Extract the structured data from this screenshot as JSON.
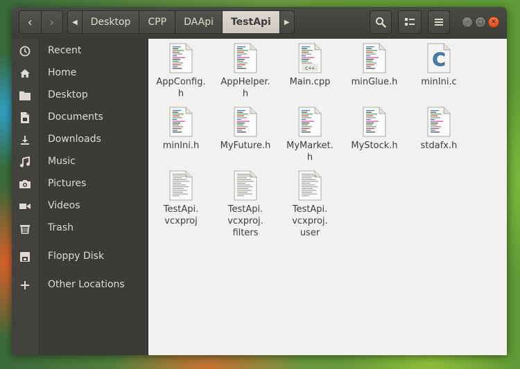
{
  "breadcrumb": {
    "items": [
      "Desktop",
      "CPP",
      "DAApi",
      "TestApi"
    ],
    "active": "TestApi"
  },
  "sidebar": {
    "items": [
      {
        "label": "Recent",
        "icon": "clock-icon"
      },
      {
        "label": "Home",
        "icon": "home-icon"
      },
      {
        "label": "Desktop",
        "icon": "folder-icon"
      },
      {
        "label": "Documents",
        "icon": "document-icon"
      },
      {
        "label": "Downloads",
        "icon": "download-icon"
      },
      {
        "label": "Music",
        "icon": "music-icon"
      },
      {
        "label": "Pictures",
        "icon": "camera-icon"
      },
      {
        "label": "Videos",
        "icon": "video-icon"
      },
      {
        "label": "Trash",
        "icon": "trash-icon"
      },
      {
        "label": "Floppy Disk",
        "icon": "floppy-icon"
      },
      {
        "label": "Other Locations",
        "icon": "plus-icon"
      }
    ]
  },
  "files": [
    {
      "name": "AppConfig.\nh",
      "type": "code"
    },
    {
      "name": "AppHelper.\nh",
      "type": "code"
    },
    {
      "name": "Main.cpp",
      "type": "cpp"
    },
    {
      "name": "minGlue.h",
      "type": "code"
    },
    {
      "name": "minIni.c",
      "type": "c"
    },
    {
      "name": "minIni.h",
      "type": "code"
    },
    {
      "name": "MyFuture.h",
      "type": "code"
    },
    {
      "name": "MyMarket.\nh",
      "type": "code"
    },
    {
      "name": "MyStock.h",
      "type": "code"
    },
    {
      "name": "stdafx.h",
      "type": "code"
    },
    {
      "name": "TestApi.\nvcxproj",
      "type": "text"
    },
    {
      "name": "TestApi.\nvcxproj.\nfilters",
      "type": "text"
    },
    {
      "name": "TestApi.\nvcxproj.\nuser",
      "type": "text"
    }
  ],
  "icon_labels": {
    "cpp": "c++",
    "c": "C"
  },
  "colors": {
    "accent": "#df4a1d",
    "sidebar": "#3c3b37",
    "headerbar": "#45453f"
  }
}
